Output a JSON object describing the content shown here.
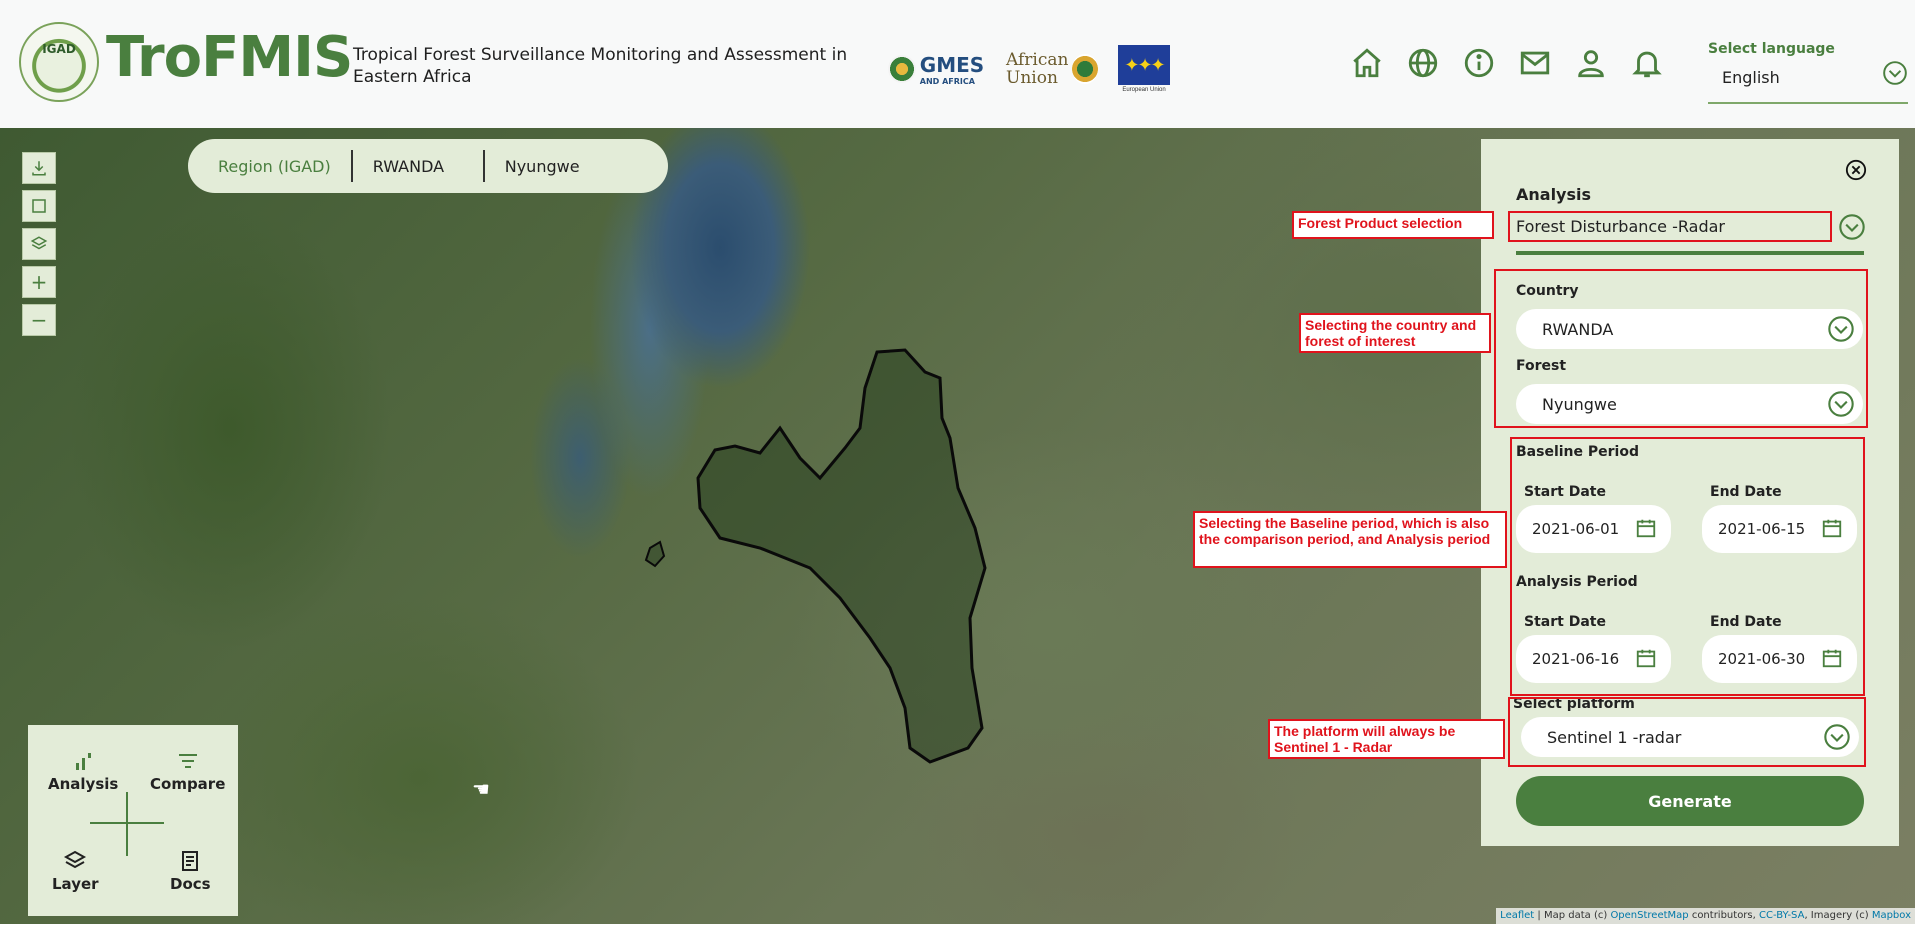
{
  "header": {
    "logo_text": "IGAD",
    "brand": "TroFMIS",
    "subtitle": "Tropical Forest Surveillance Monitoring and Assessment in Eastern Africa",
    "partners": {
      "gmes_main": "GMES",
      "gmes_sub": "AND AFRICA",
      "au_line1": "African",
      "au_line2": "Union",
      "eu_caption": "European Union"
    },
    "nav_icons": [
      "home-icon",
      "globe-icon",
      "info-icon",
      "mail-icon",
      "user-icon",
      "bell-icon"
    ],
    "language": {
      "label": "Select language",
      "value": "English"
    }
  },
  "breadcrumb": [
    "Region (IGAD)",
    "RWANDA",
    "Nyungwe"
  ],
  "map_controls": {
    "zoom_in": "+",
    "zoom_out": "−",
    "icons": [
      "download-icon",
      "draw-rectangle-icon",
      "layers-icon",
      "zoom-in-icon",
      "zoom-out-icon"
    ]
  },
  "tools": {
    "analysis": "Analysis",
    "compare": "Compare",
    "layer": "Layer",
    "docs": "Docs"
  },
  "panel": {
    "title": "Analysis",
    "product": "Forest Disturbance -Radar",
    "country_label": "Country",
    "country": "RWANDA",
    "forest_label": "Forest",
    "forest": "Nyungwe",
    "baseline_label": "Baseline Period",
    "baseline_start_label": "Start Date",
    "baseline_start": "2021-06-01",
    "baseline_end_label": "End Date",
    "baseline_end": "2021-06-15",
    "analysis_label": "Analysis Period",
    "analysis_start_label": "Start Date",
    "analysis_start": "2021-06-16",
    "analysis_end_label": "End Date",
    "analysis_end": "2021-06-30",
    "platform_label": "Select platform",
    "platform": "Sentinel 1 -radar",
    "generate": "Generate"
  },
  "annotations": {
    "product": "Forest Product selection",
    "country_forest": "Selecting the country and forest of interest",
    "periods": "Selecting the Baseline period, which is also the comparison period, and Analysis period",
    "platform": "The platform will always be Sentinel 1 - Radar"
  },
  "attribution": {
    "leaflet": "Leaflet",
    "text1": " | Map data (c) ",
    "osm": "OpenStreetMap",
    "text2": " contributors, ",
    "license": "CC-BY-SA",
    "text3": ", Imagery (c) ",
    "mapbox": "Mapbox"
  },
  "colors": {
    "brand_green": "#4a7f3f",
    "panel_bg": "#e3ecd8",
    "annotation_red": "#e0131c"
  }
}
